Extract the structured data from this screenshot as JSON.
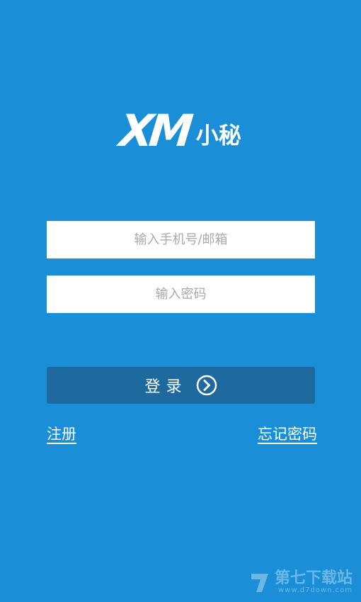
{
  "logo": {
    "mark": "XM",
    "subtitle": "小秘"
  },
  "form": {
    "account_placeholder": "输入手机号/邮箱",
    "password_placeholder": "输入密码"
  },
  "login": {
    "label": "登录",
    "arrow_icon": "chevron-circle-right-icon"
  },
  "links": {
    "register": "注册",
    "forgot_password": "忘记密码"
  },
  "watermark": {
    "title": "第七下载站",
    "url": "www.d7down.com"
  },
  "colors": {
    "background": "#1a8fd8",
    "button": "#1e6a9e",
    "field": "#ffffff",
    "placeholder": "#a9a9a9",
    "text": "#ffffff"
  }
}
